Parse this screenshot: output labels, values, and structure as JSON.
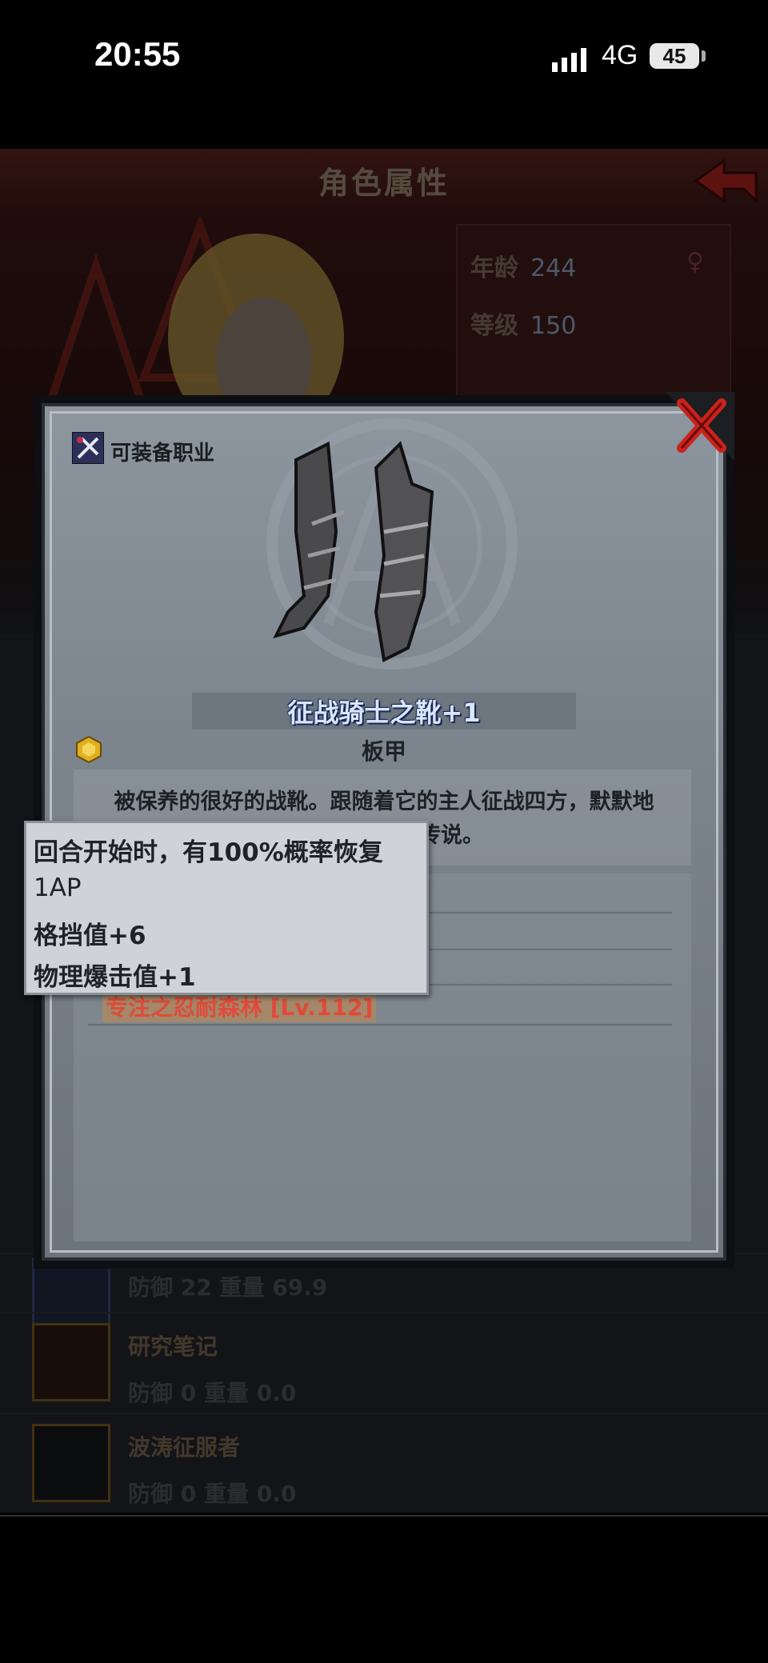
{
  "status_bar": {
    "time": "20:55",
    "network": "4G",
    "battery": "45"
  },
  "screen": {
    "title": "角色属性",
    "profile": {
      "age_label": "年龄",
      "age_value": "244",
      "level_label": "等级",
      "level_value": "150"
    }
  },
  "equipment_list": [
    {
      "name": "",
      "defense_label": "防御",
      "defense_value": "22",
      "weight_label": "重量",
      "weight_value": "69.9"
    },
    {
      "name": "研究笔记",
      "defense_label": "防御",
      "defense_value": "0",
      "weight_label": "重量",
      "weight_value": "0.0"
    },
    {
      "name": "波涛征服者",
      "defense_label": "防御",
      "defense_value": "0",
      "weight_label": "重量",
      "weight_value": "0.0"
    }
  ],
  "item_dialog": {
    "job_label": "可装备职业",
    "item_name": "征战骑士之靴+1",
    "item_type": "板甲",
    "description_line1": "被保养的很好的战靴。跟随着它的主人征战四方，默默地",
    "description_line2": "下的传说。",
    "stat_partial": ")",
    "set_bonus": "专注之忍耐森林 [Lv.112]"
  },
  "tooltip": {
    "line1": "回合开始时，有100%概率恢复",
    "line2": "1AP",
    "line3": "格挡值+6",
    "line4": "物理爆击值+1"
  },
  "colors": {
    "header_red": "#5b2320",
    "dialog_gray": "#7c848d",
    "title_blue": "#dbe6ff",
    "set_red": "#e04a3a"
  }
}
